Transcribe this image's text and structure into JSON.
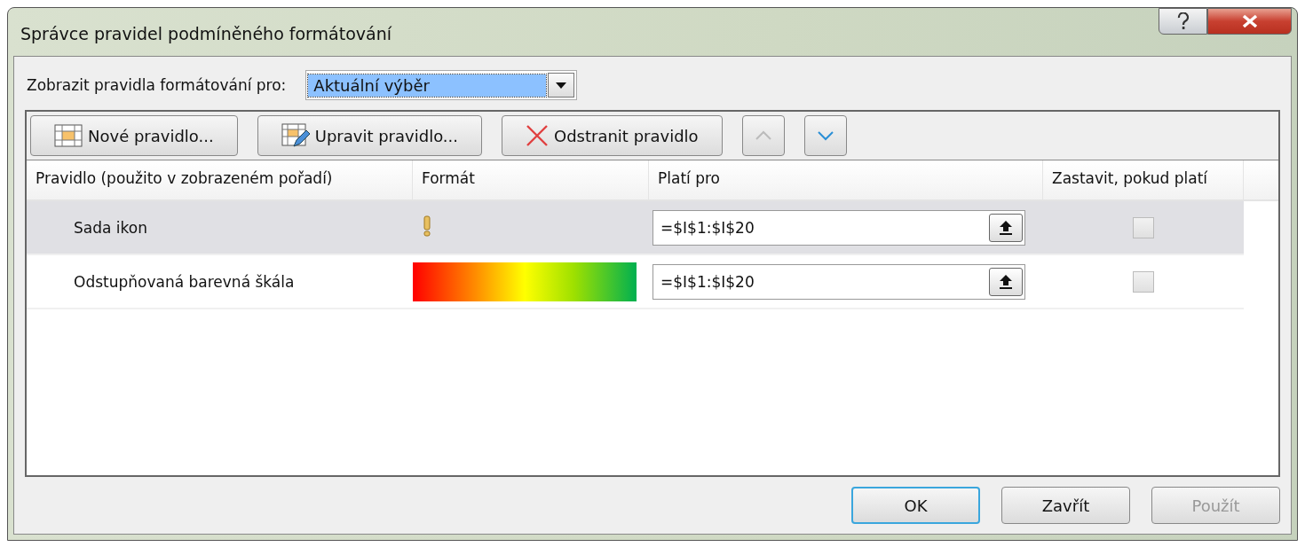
{
  "window": {
    "title": "Správce pravidel podmíněného formátování"
  },
  "scope": {
    "label": "Zobrazit pravidla formátování pro:",
    "value": "Aktuální výběr"
  },
  "toolbar": [
    {
      "kind": "new",
      "label": "Nové pravidlo...",
      "disabled": false
    },
    {
      "kind": "edit",
      "label": "Upravit pravidlo...",
      "disabled": false
    },
    {
      "kind": "delete",
      "label": "Odstranit pravidlo",
      "disabled": false
    },
    {
      "kind": "up",
      "disabled": true
    },
    {
      "kind": "down",
      "disabled": false
    }
  ],
  "table": {
    "columns": [
      "Pravidlo (použito v zobrazeném pořadí)",
      "Formát",
      "Platí pro",
      "Zastavit, pokud platí"
    ],
    "rows": [
      {
        "rule": "Sada ikon",
        "kind": "icon-set",
        "applies_to": "=$I$1:$I$20",
        "stop": false,
        "selected": true
      },
      {
        "rule": "Odstupňovaná barevná škála",
        "kind": "color-scale",
        "applies_to": "=$I$1:$I$20",
        "stop": false,
        "selected": false
      }
    ]
  },
  "buttons": [
    {
      "label": "OK",
      "default": true,
      "disabled": false
    },
    {
      "label": "Zavřít",
      "default": false,
      "disabled": false
    },
    {
      "label": "Použít",
      "default": false,
      "disabled": true
    }
  ]
}
